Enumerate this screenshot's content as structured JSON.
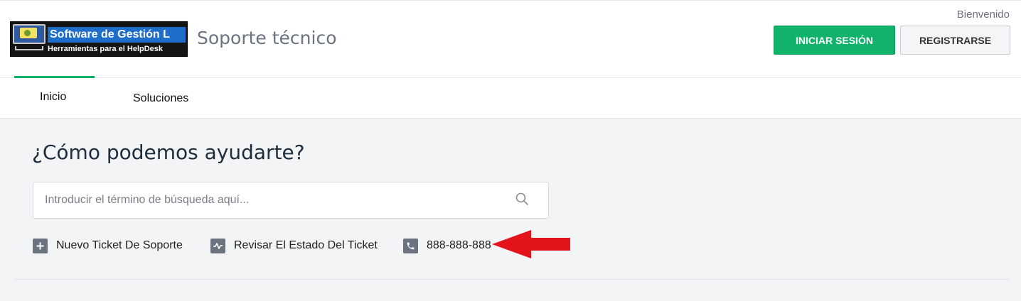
{
  "header": {
    "logo": {
      "line1": "Software de Gestión L",
      "line2": "Herramientas para el HelpDesk",
      "icon": "monitor-logo-icon"
    },
    "site_title": "Soporte técnico",
    "welcome": "Bienvenido",
    "login_label": "INICIAR SESIÓN",
    "register_label": "REGISTRARSE"
  },
  "nav": {
    "tabs": [
      {
        "label": "Inicio",
        "active": true
      },
      {
        "label": "Soluciones",
        "active": false
      }
    ]
  },
  "main": {
    "headline": "¿Cómo podemos ayudarte?",
    "search": {
      "placeholder": "Introducir el término de búsqueda aquí...",
      "value": "",
      "icon": "search-icon"
    },
    "links": [
      {
        "label": "Nuevo Ticket De Soporte",
        "icon": "plus-icon"
      },
      {
        "label": "Revisar El Estado Del Ticket",
        "icon": "pulse-icon"
      },
      {
        "label": "888-888-888",
        "icon": "phone-icon"
      }
    ],
    "annotation": {
      "icon": "red-arrow-icon"
    }
  },
  "colors": {
    "accent_green": "#11b36a",
    "background_gray": "#f3f4f6",
    "icon_gray": "#6b7280",
    "headline": "#1e2d3d",
    "arrow_red": "#e3141b"
  }
}
